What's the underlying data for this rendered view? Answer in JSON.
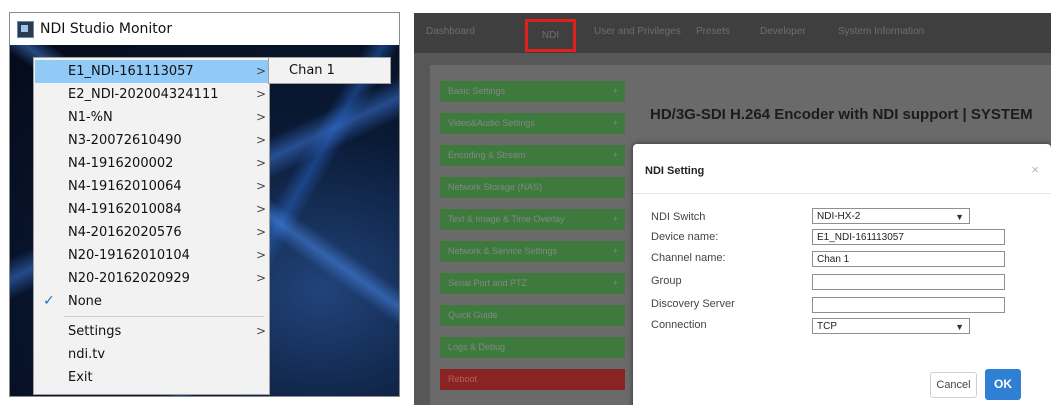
{
  "monitor": {
    "title": "NDI Studio Monitor",
    "menu": {
      "items": [
        {
          "label": "E1_NDI-161113057",
          "arrow": ">"
        },
        {
          "label": "E2_NDI-202004324111",
          "arrow": ">"
        },
        {
          "label": "N1-%N",
          "arrow": ">"
        },
        {
          "label": "N3-20072610490",
          "arrow": ">"
        },
        {
          "label": "N4-1916200002",
          "arrow": ">"
        },
        {
          "label": "N4-19162010064",
          "arrow": ">"
        },
        {
          "label": "N4-19162010084",
          "arrow": ">"
        },
        {
          "label": "N4-20162020576",
          "arrow": ">"
        },
        {
          "label": "N20-19162010104",
          "arrow": ">"
        },
        {
          "label": "N20-20162020929",
          "arrow": ">"
        },
        {
          "label": "None",
          "check": "✓"
        },
        {
          "label": "Settings",
          "arrow": ">"
        },
        {
          "label": "ndi.tv"
        },
        {
          "label": "Exit"
        }
      ]
    },
    "submenu": {
      "items": [
        {
          "label": "Chan 1"
        }
      ]
    }
  },
  "web": {
    "nav": {
      "items": [
        "Dashboard",
        "NDI",
        "User and Privileges",
        "Presets",
        "Developer",
        "System Information"
      ]
    },
    "sidebar": {
      "items": [
        {
          "label": "Basic Settings",
          "plus": "+"
        },
        {
          "label": "Video&Audio Settings",
          "plus": "+"
        },
        {
          "label": "Encoding & Stream",
          "plus": "+"
        },
        {
          "label": "Network Storage (NAS)",
          "plus": ""
        },
        {
          "label": "Text & Image & Time Overlay",
          "plus": "+"
        },
        {
          "label": "Network & Service Settings",
          "plus": "+"
        },
        {
          "label": "Serial Port and PTZ",
          "plus": "+"
        },
        {
          "label": "Quick Guide",
          "plus": ""
        },
        {
          "label": "Logs & Debug",
          "plus": ""
        },
        {
          "label": "Reboot",
          "plus": ""
        }
      ]
    },
    "page_title": "HD/3G-SDI H.264 Encoder with NDI support | SYSTEM",
    "dialog": {
      "title": "NDI Setting",
      "close": "×",
      "fields": [
        {
          "label": "NDI Switch",
          "value": "NDI-HX-2"
        },
        {
          "label": "Device name:",
          "value": "E1_NDI-161113057"
        },
        {
          "label": "Channel name:",
          "value": "Chan 1"
        },
        {
          "label": "Group",
          "value": ""
        },
        {
          "label": "Discovery Server",
          "value": ""
        },
        {
          "label": "Connection",
          "value": "TCP"
        }
      ],
      "cancel_label": "Cancel",
      "ok_label": "OK"
    }
  },
  "colors": {
    "menu_highlight": "#91c9f7",
    "ndi_highlight_box": "#e0201b",
    "ok_button": "#2f7fd3",
    "reboot_button": "#8a2424"
  }
}
